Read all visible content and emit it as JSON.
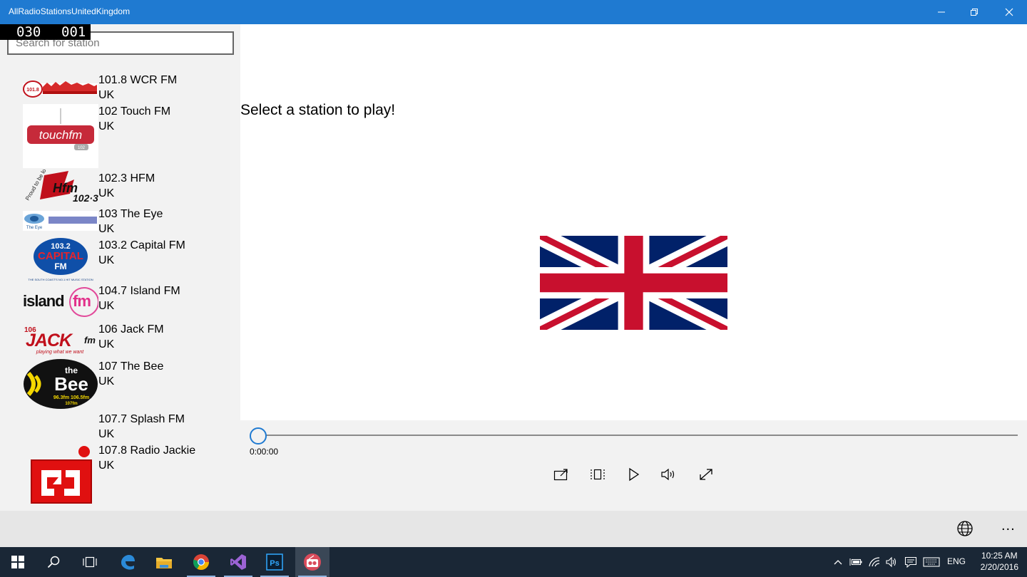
{
  "window": {
    "title": "AllRadioStationsUnitedKingdom",
    "minimize_icon": "minimize-icon",
    "restore_icon": "restore-icon",
    "close_icon": "close-icon"
  },
  "counter": {
    "left": "030",
    "right": "001"
  },
  "search": {
    "placeholder": "Search for station",
    "value": ""
  },
  "stations": [
    {
      "name": "101.8 WCR FM",
      "country": "UK",
      "logo_text": "101.8 WCR FM"
    },
    {
      "name": "102 Touch FM",
      "country": "UK",
      "logo_text": "touchfm"
    },
    {
      "name": "102.3 HFM",
      "country": "UK",
      "logo_text": "HFM 102.3"
    },
    {
      "name": "103 The Eye",
      "country": "UK",
      "logo_text": "The Eye"
    },
    {
      "name": "103.2 Capital FM",
      "country": "UK",
      "logo_text": "103.2 CAPITAL FM"
    },
    {
      "name": "104.7 Island FM",
      "country": "UK",
      "logo_text": "islandfm"
    },
    {
      "name": "106 Jack FM",
      "country": "UK",
      "logo_text": "106 JACK fm"
    },
    {
      "name": "107 The Bee",
      "country": "UK",
      "logo_text": "the Bee"
    },
    {
      "name": "107.7 Splash FM",
      "country": "UK",
      "logo_text": ""
    },
    {
      "name": "107.8 Radio Jackie",
      "country": "UK",
      "logo_text": "RJ"
    }
  ],
  "main": {
    "prompt": "Select a station to play!",
    "flag": "union-jack-flag"
  },
  "player": {
    "time": "0:00:00",
    "progress": 0,
    "controls": [
      "cast-icon",
      "aspect-ratio-icon",
      "play-icon",
      "volume-icon",
      "fullscreen-icon"
    ]
  },
  "appbar": {
    "globe_icon": "globe-icon",
    "more_label": "..."
  },
  "taskbar": {
    "apps": [
      "windows-start-icon",
      "search-icon",
      "task-view-icon",
      "edge-icon",
      "file-explorer-icon",
      "chrome-icon",
      "visual-studio-icon",
      "photoshop-icon",
      "radio-app-icon"
    ],
    "language": "ENG",
    "time": "10:25 AM",
    "date": "2/20/2016"
  },
  "colors": {
    "titlebar": "#1f7ad1",
    "sidebar": "#f2f2f2",
    "player": "#f2f2f2",
    "appbar": "#e6e6e6",
    "taskbar": "#1a2736",
    "flag_blue": "#012169",
    "flag_red": "#c8102e"
  }
}
